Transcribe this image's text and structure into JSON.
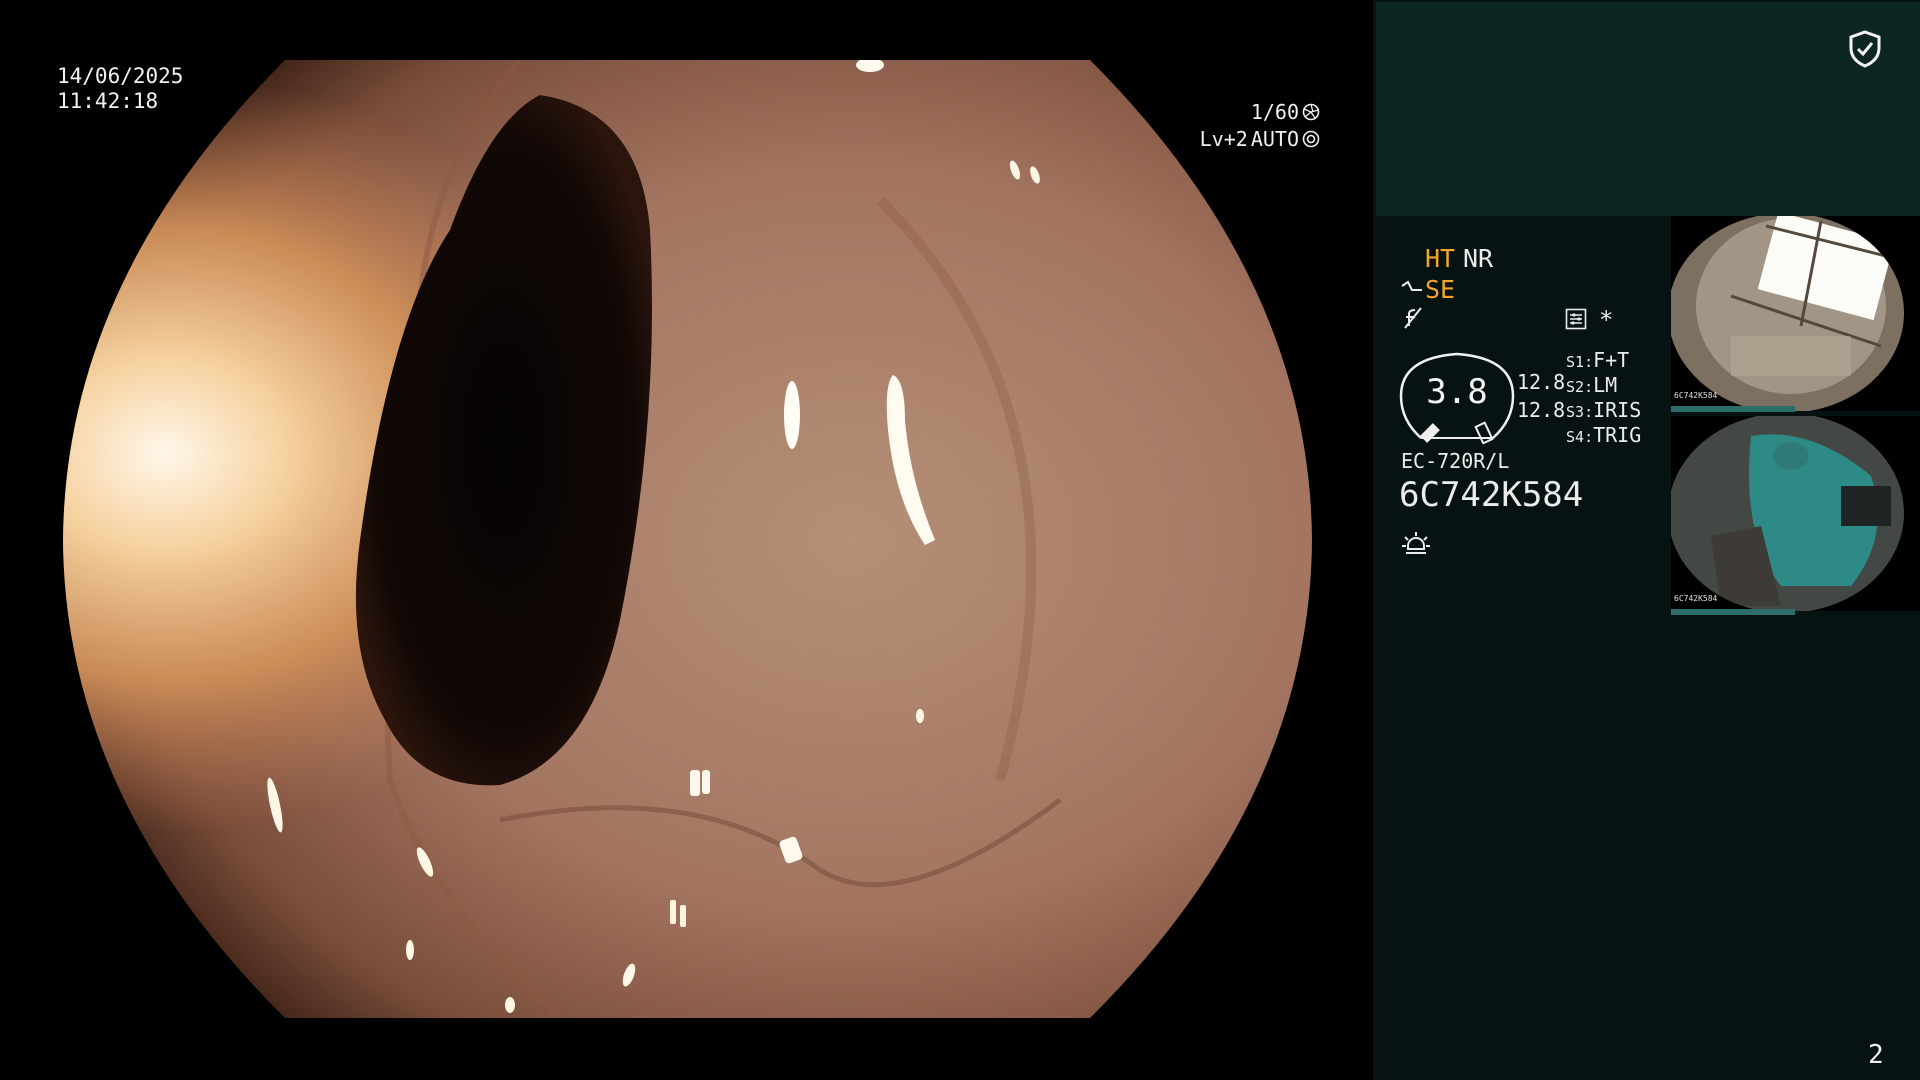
{
  "overlay": {
    "date": "14/06/2025",
    "time": "11:42:18",
    "shutter_speed": "1/60",
    "level": "Lv+2",
    "iris_mode": "AUTO"
  },
  "panel": {
    "mode_ht": "HT",
    "mode_nr": "NR",
    "mode_se": "SE",
    "star": "*",
    "dial_value": "3.8",
    "value_a": "12.8",
    "value_b": "12.8",
    "switches": [
      {
        "key": "S1",
        "value": "F+T"
      },
      {
        "key": "S2",
        "value": "LM"
      },
      {
        "key": "S3",
        "value": "IRIS"
      },
      {
        "key": "S4",
        "value": "TRIG"
      }
    ],
    "scope_model": "EC-720R/L",
    "scope_serial": "6C742K584",
    "page_number": "2",
    "icons": {
      "shield": "shield-check-icon",
      "se": "se-curve-icon",
      "f": "f-slash-icon",
      "menu": "settings-menu-icon",
      "light": "light-sun-icon",
      "shutter": "shutter-icon",
      "iris": "iris-icon"
    },
    "colors": {
      "panel_bg": "#071312",
      "top_block": "#0c2624",
      "accent_orange": "#f4a62a",
      "thumb_bar": "#2d6e6a"
    }
  },
  "thumbnails": [
    {
      "label": "6C742K584"
    },
    {
      "label": "6C742K584"
    }
  ]
}
